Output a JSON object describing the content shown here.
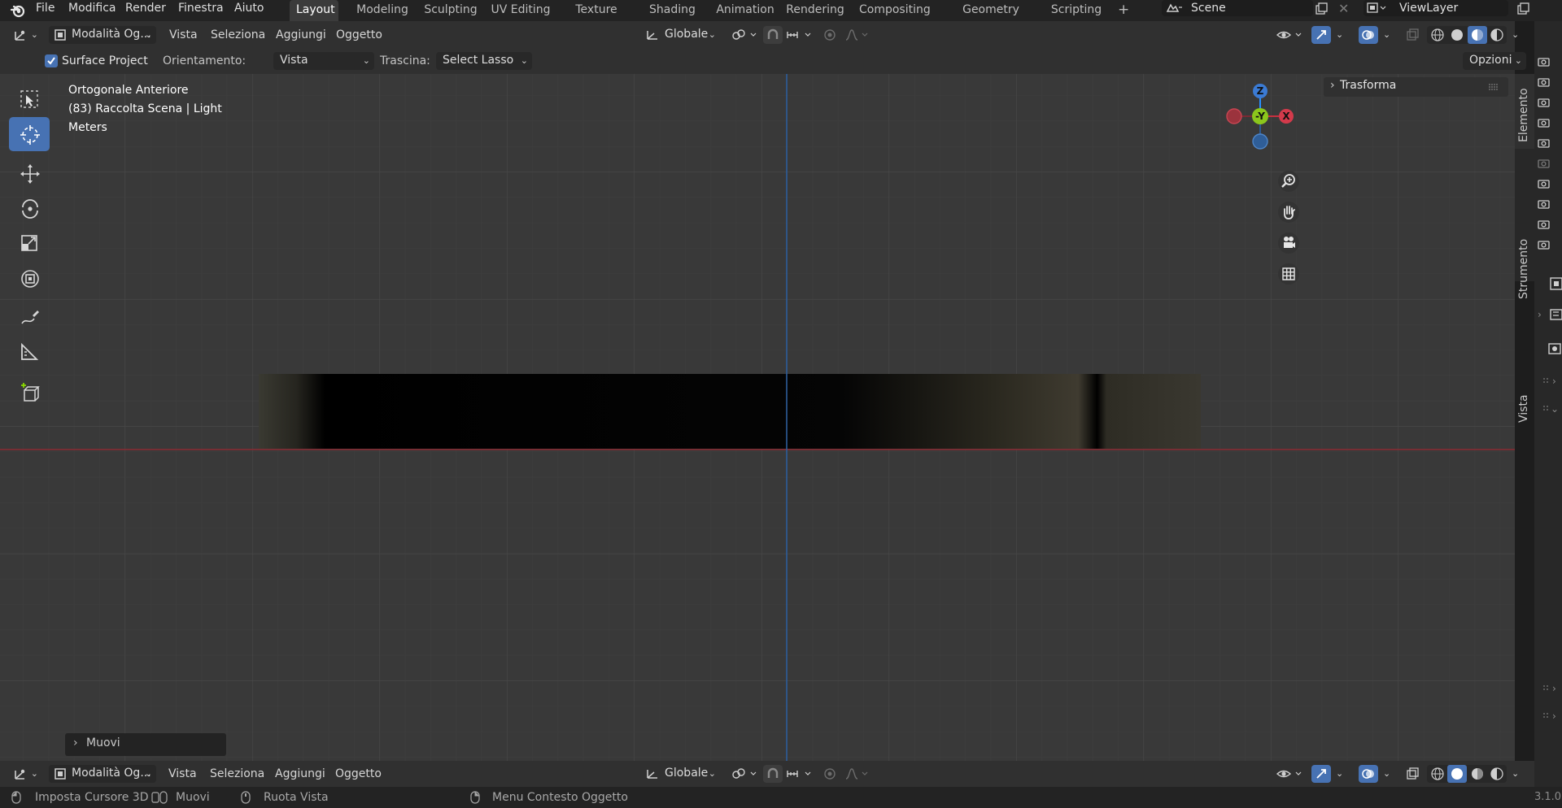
{
  "topbar": {
    "menus": [
      "File",
      "Modifica",
      "Render",
      "Finestra",
      "Aiuto"
    ],
    "workspaces": [
      "Layout",
      "Modeling",
      "Sculpting",
      "UV Editing",
      "Texture Paint",
      "Shading",
      "Animation",
      "Rendering",
      "Compositing",
      "Geometry Nodes",
      "Scripting"
    ],
    "active_workspace": "Layout",
    "add_tab": "+",
    "scene": "Scene",
    "view_layer": "ViewLayer"
  },
  "header": {
    "mode": "Modalità Og...",
    "menus": [
      "Vista",
      "Seleziona",
      "Aggiungi",
      "Oggetto"
    ],
    "transform_orientation": "Globale"
  },
  "tool_settings": {
    "surface_project_label": "Surface Project",
    "surface_project_checked": true,
    "orientation_label": "Orientamento:",
    "orientation_value": "Vista",
    "drag_label": "Trascina:",
    "drag_value": "Select Lasso",
    "options": "Opzioni"
  },
  "viewport": {
    "view_name": "Ortogonale Anteriore",
    "collection_info": "(83) Raccolta Scena | Light",
    "units": "Meters",
    "gizmo_axes": {
      "z": "Z",
      "x": "X",
      "y": "-Y"
    },
    "sidebar_panel": "Trasforma",
    "last_operator": "Muovi",
    "side_tabs": [
      "Elemento",
      "Strumento",
      "Vista"
    ]
  },
  "bottom_header": {
    "mode": "Modalità Og...",
    "menus": [
      "Vista",
      "Seleziona",
      "Aggiungi",
      "Oggetto"
    ],
    "transform_orientation": "Globale"
  },
  "statusbar": {
    "hint1": "Imposta Cursore 3D",
    "hint2": "Muovi",
    "hint3": "Ruota Vista",
    "hint4": "Menu Contesto Oggetto",
    "version": "3.1.0"
  },
  "colors": {
    "accent": "#4772b3",
    "axis_x": "#ff3352",
    "axis_y": "#8bdc00",
    "axis_z": "#2890ff"
  }
}
